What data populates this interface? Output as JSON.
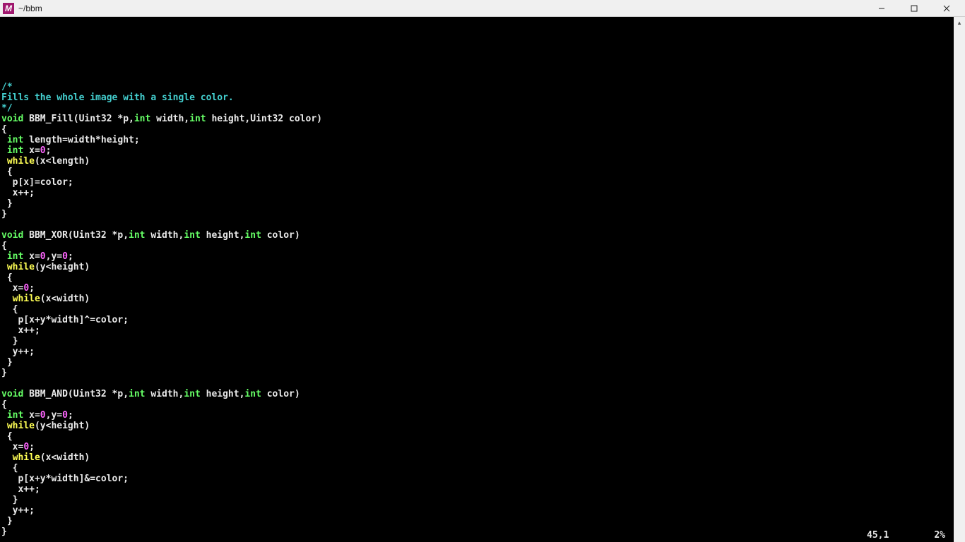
{
  "window": {
    "title": "~/bbm",
    "icon_glyph": "M"
  },
  "status": {
    "position": "45,1",
    "percent": "2%"
  },
  "code": {
    "lines": [
      [
        [
          "comment",
          "/*"
        ]
      ],
      [
        [
          "comment",
          "Fills the whole image with a single color."
        ]
      ],
      [
        [
          "comment",
          "*/"
        ]
      ],
      [
        [
          "type",
          "void"
        ],
        [
          "plain",
          " BBM_Fill(Uint32 *p,"
        ],
        [
          "type",
          "int"
        ],
        [
          "plain",
          " width,"
        ],
        [
          "type",
          "int"
        ],
        [
          "plain",
          " height,Uint32 color)"
        ]
      ],
      [
        [
          "plain",
          "{"
        ]
      ],
      [
        [
          "plain",
          " "
        ],
        [
          "type",
          "int"
        ],
        [
          "plain",
          " length=width*height;"
        ]
      ],
      [
        [
          "plain",
          " "
        ],
        [
          "type",
          "int"
        ],
        [
          "plain",
          " x="
        ],
        [
          "num",
          "0"
        ],
        [
          "plain",
          ";"
        ]
      ],
      [
        [
          "plain",
          " "
        ],
        [
          "key",
          "while"
        ],
        [
          "plain",
          "(x<length)"
        ]
      ],
      [
        [
          "plain",
          " {"
        ]
      ],
      [
        [
          "plain",
          "  p[x]=color;"
        ]
      ],
      [
        [
          "plain",
          "  x++;"
        ]
      ],
      [
        [
          "plain",
          " }"
        ]
      ],
      [
        [
          "plain",
          "}"
        ]
      ],
      [
        [
          "plain",
          ""
        ]
      ],
      [
        [
          "type",
          "void"
        ],
        [
          "plain",
          " BBM_XOR(Uint32 *p,"
        ],
        [
          "type",
          "int"
        ],
        [
          "plain",
          " width,"
        ],
        [
          "type",
          "int"
        ],
        [
          "plain",
          " height,"
        ],
        [
          "type",
          "int"
        ],
        [
          "plain",
          " color)"
        ]
      ],
      [
        [
          "plain",
          "{"
        ]
      ],
      [
        [
          "plain",
          " "
        ],
        [
          "type",
          "int"
        ],
        [
          "plain",
          " x="
        ],
        [
          "num",
          "0"
        ],
        [
          "plain",
          ",y="
        ],
        [
          "num",
          "0"
        ],
        [
          "plain",
          ";"
        ]
      ],
      [
        [
          "plain",
          " "
        ],
        [
          "key",
          "while"
        ],
        [
          "plain",
          "(y<height)"
        ]
      ],
      [
        [
          "plain",
          " {"
        ]
      ],
      [
        [
          "plain",
          "  x="
        ],
        [
          "num",
          "0"
        ],
        [
          "plain",
          ";"
        ]
      ],
      [
        [
          "plain",
          "  "
        ],
        [
          "key",
          "while"
        ],
        [
          "plain",
          "(x<width)"
        ]
      ],
      [
        [
          "plain",
          "  {"
        ]
      ],
      [
        [
          "plain",
          "   p[x+y*width]^=color;"
        ]
      ],
      [
        [
          "plain",
          "   x++;"
        ]
      ],
      [
        [
          "plain",
          "  }"
        ]
      ],
      [
        [
          "plain",
          "  y++;"
        ]
      ],
      [
        [
          "plain",
          " }"
        ]
      ],
      [
        [
          "plain",
          "}"
        ]
      ],
      [
        [
          "plain",
          ""
        ]
      ],
      [
        [
          "type",
          "void"
        ],
        [
          "plain",
          " BBM_AND(Uint32 *p,"
        ],
        [
          "type",
          "int"
        ],
        [
          "plain",
          " width,"
        ],
        [
          "type",
          "int"
        ],
        [
          "plain",
          " height,"
        ],
        [
          "type",
          "int"
        ],
        [
          "plain",
          " color)"
        ]
      ],
      [
        [
          "plain",
          "{"
        ]
      ],
      [
        [
          "plain",
          " "
        ],
        [
          "type",
          "int"
        ],
        [
          "plain",
          " x="
        ],
        [
          "num",
          "0"
        ],
        [
          "plain",
          ",y="
        ],
        [
          "num",
          "0"
        ],
        [
          "plain",
          ";"
        ]
      ],
      [
        [
          "plain",
          " "
        ],
        [
          "key",
          "while"
        ],
        [
          "plain",
          "(y<height)"
        ]
      ],
      [
        [
          "plain",
          " {"
        ]
      ],
      [
        [
          "plain",
          "  x="
        ],
        [
          "num",
          "0"
        ],
        [
          "plain",
          ";"
        ]
      ],
      [
        [
          "plain",
          "  "
        ],
        [
          "key",
          "while"
        ],
        [
          "plain",
          "(x<width)"
        ]
      ],
      [
        [
          "plain",
          "  {"
        ]
      ],
      [
        [
          "plain",
          "   p[x+y*width]&=color;"
        ]
      ],
      [
        [
          "plain",
          "   x++;"
        ]
      ],
      [
        [
          "plain",
          "  }"
        ]
      ],
      [
        [
          "plain",
          "  y++;"
        ]
      ],
      [
        [
          "plain",
          " }"
        ]
      ],
      [
        [
          "plain",
          "}"
        ]
      ]
    ]
  }
}
